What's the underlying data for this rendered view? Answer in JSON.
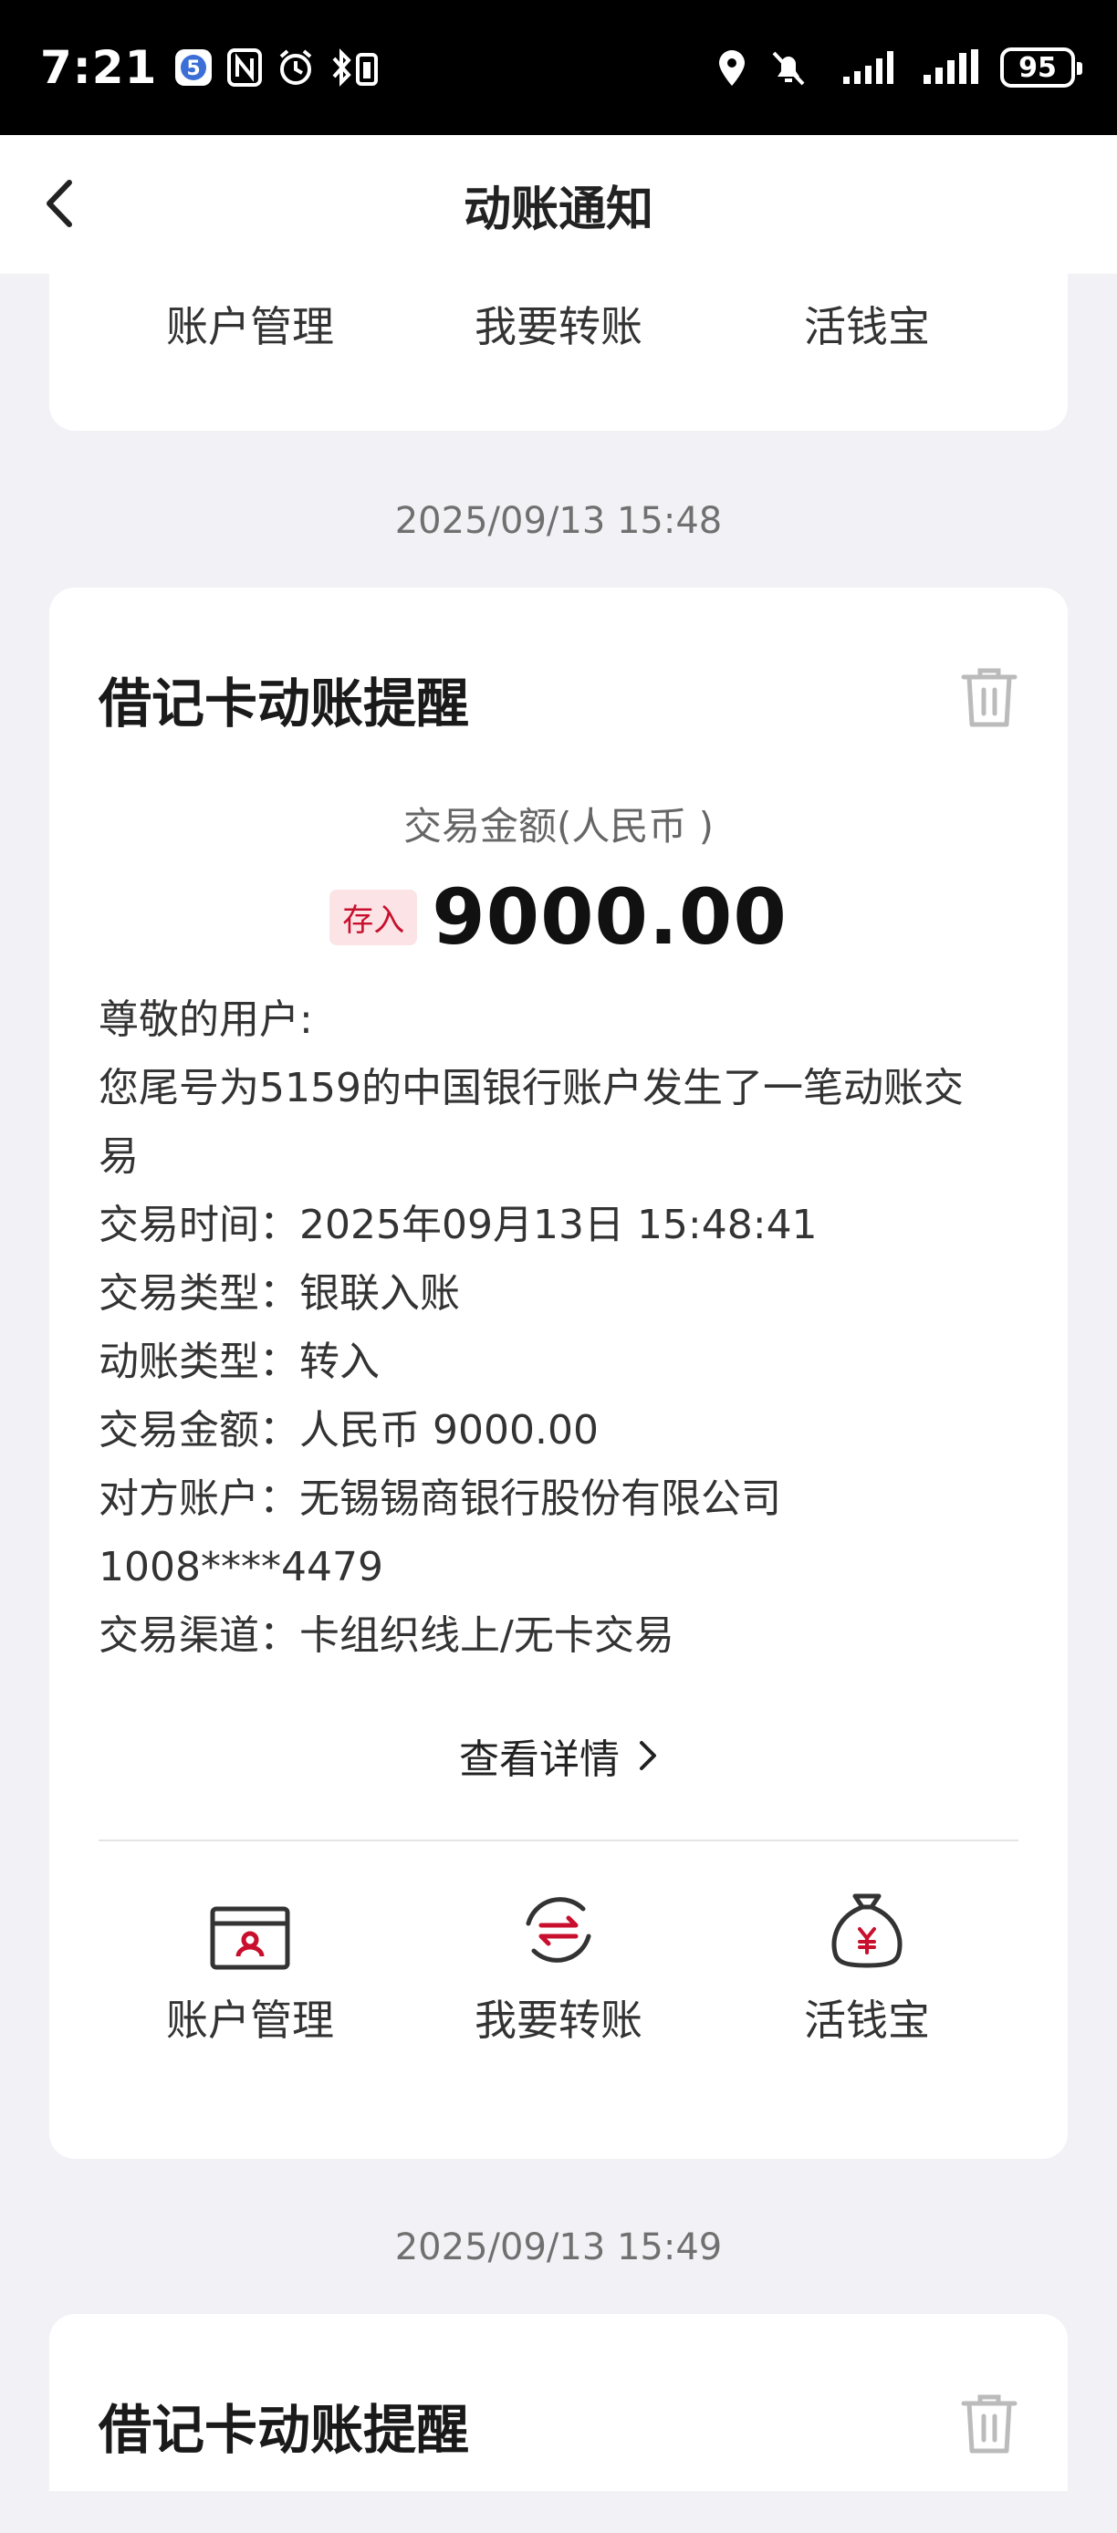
{
  "status_bar": {
    "time": "7:21",
    "battery": "95"
  },
  "nav": {
    "title": "动账通知"
  },
  "actions": [
    {
      "label": "账户管理",
      "icon": "account-management-icon"
    },
    {
      "label": "我要转账",
      "icon": "transfer-icon"
    },
    {
      "label": "活钱宝",
      "icon": "money-bag-icon"
    }
  ],
  "messages": [
    {
      "timestamp": "2025/09/13 15:48",
      "title": "借记卡动账提醒",
      "amount_label": "交易金额(人民币 )",
      "badge": "存入",
      "amount": "9000.00",
      "lines": [
        "尊敬的用户:",
        "您尾号为5159的中国银行账户发生了一笔动账交",
        "易",
        "交易时间：2025年09月13日 15:48:41",
        "交易类型：银联入账",
        "动账类型：转入",
        "交易金额：人民币 9000.00",
        "对方账户：无锡锡商银行股份有限公司",
        "1008****4479",
        "交易渠道：卡组织线上/无卡交易"
      ],
      "detail_link": "查看详情"
    },
    {
      "timestamp": "2025/09/13 15:49",
      "title": "借记卡动账提醒"
    }
  ],
  "colors": {
    "accent": "#c8102e",
    "background": "#f2f2f6",
    "card": "#ffffff"
  }
}
